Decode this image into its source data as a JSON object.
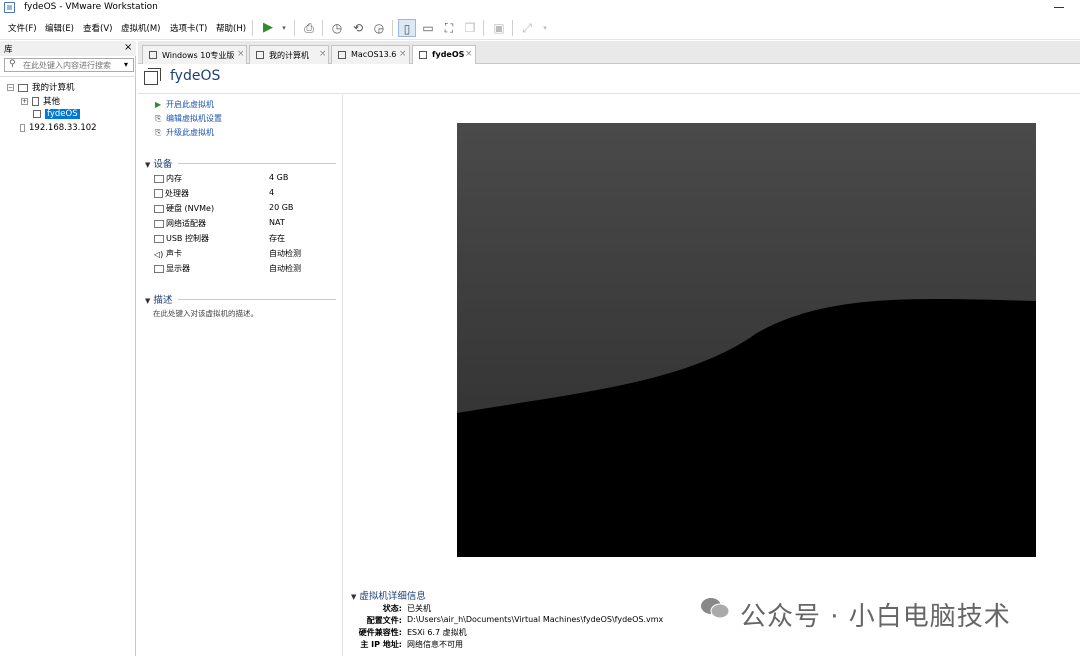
{
  "window": {
    "title": "fydeOS - VMware Workstation"
  },
  "menu": {
    "items": [
      "文件(F)",
      "编辑(E)",
      "查看(V)",
      "虚拟机(M)",
      "选项卡(T)",
      "帮助(H)"
    ]
  },
  "library": {
    "header": "库",
    "close": "×",
    "search_placeholder": "在此处键入内容进行搜索",
    "tree": {
      "root": "我的计算机",
      "other": "其他",
      "selected": "fydeOS",
      "remote": "192.168.33.102"
    }
  },
  "tabs": [
    {
      "label": "Windows 10专业版",
      "close": "×"
    },
    {
      "label": "我的计算机",
      "close": "×"
    },
    {
      "label": "MacOS13.6",
      "close": "×"
    },
    {
      "label": "fydeOS",
      "close": "×"
    }
  ],
  "vm": {
    "name": "fydeOS",
    "actions": {
      "power_on": "开启此虚拟机",
      "edit_settings": "编辑虚拟机设置",
      "upgrade": "升级此虚拟机"
    },
    "devices_title": "设备",
    "devices": [
      {
        "name": "内存",
        "value": "4 GB",
        "icon": "memory-icon"
      },
      {
        "name": "处理器",
        "value": "4",
        "icon": "cpu-icon"
      },
      {
        "name": "硬盘 (NVMe)",
        "value": "20 GB",
        "icon": "hard-disk-icon"
      },
      {
        "name": "网络适配器",
        "value": "NAT",
        "icon": "network-icon"
      },
      {
        "name": "USB 控制器",
        "value": "存在",
        "icon": "usb-icon"
      },
      {
        "name": "声卡",
        "value": "自动检测",
        "icon": "speaker-icon"
      },
      {
        "name": "显示器",
        "value": "自动检测",
        "icon": "monitor-icon"
      }
    ],
    "description_title": "描述",
    "description_placeholder": "在此处键入对该虚拟机的描述。",
    "details_title": "虚拟机详细信息",
    "details": [
      {
        "key": "状态:",
        "value": "已关机"
      },
      {
        "key": "配置文件:",
        "value": "D:\\Users\\air_h\\Documents\\Virtual Machines\\fydeOS\\fydeOS.vmx"
      },
      {
        "key": "硬件兼容性:",
        "value": "ESXi 6.7 虚拟机"
      },
      {
        "key": "主 IP 地址:",
        "value": "网络信息不可用"
      }
    ]
  },
  "watermark": {
    "text": "公众号 · 小白电脑技术"
  },
  "colors": {
    "accent": "#1a54b3",
    "title_blue": "#1f3f73",
    "selection": "#0078d7",
    "play_green": "#2e8b2e"
  }
}
